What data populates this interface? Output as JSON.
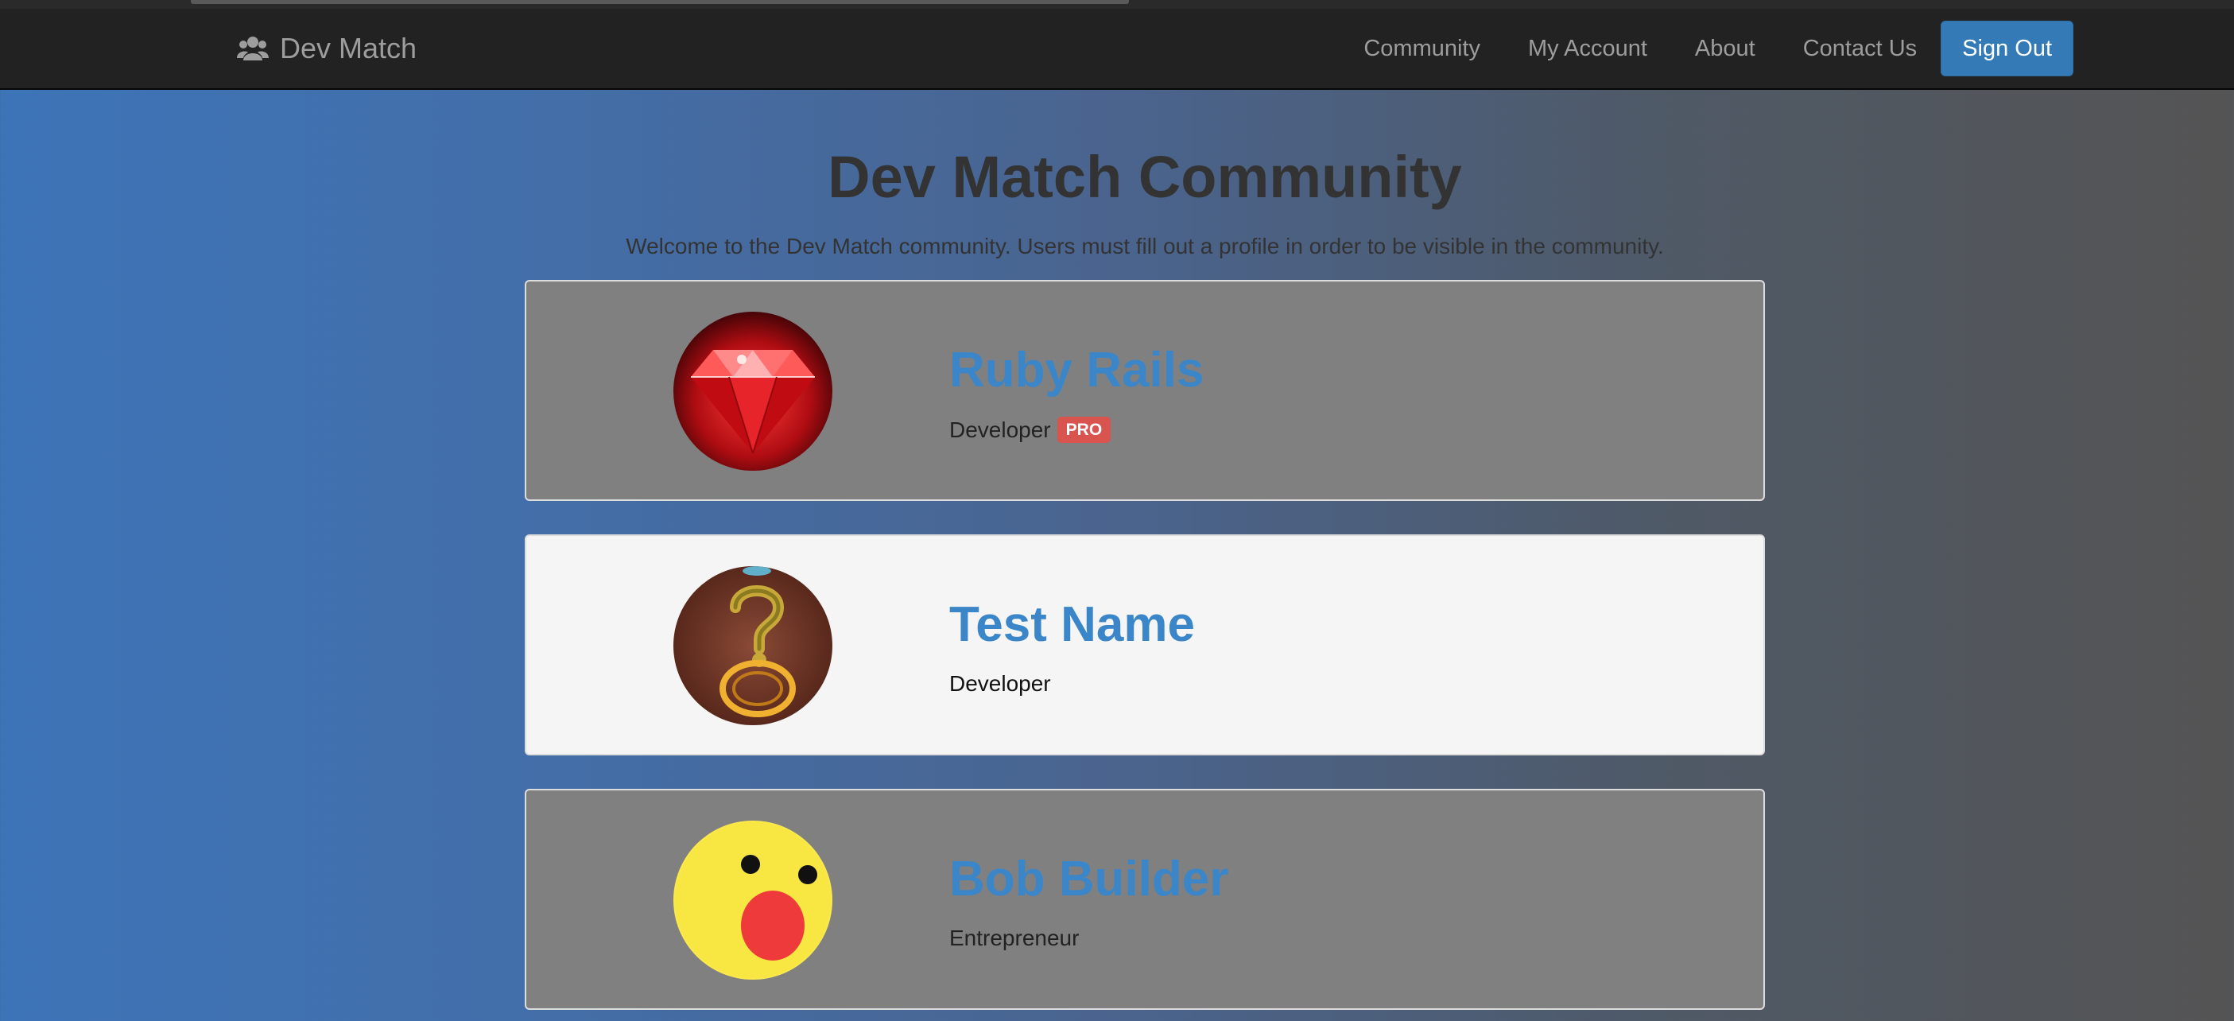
{
  "navbar": {
    "brand_icon": "users-icon",
    "brand": "Dev Match",
    "links": [
      "Community",
      "My Account",
      "About",
      "Contact Us"
    ],
    "sign_out": "Sign Out"
  },
  "page": {
    "title": "Dev Match Community",
    "subtitle": "Welcome to the Dev Match community. Users must fill out a profile in order to be visible in the community."
  },
  "profiles": [
    {
      "name": "Ruby Rails",
      "job_title": "Developer",
      "badge": "PRO",
      "avatar": "ruby-gem-avatar"
    },
    {
      "name": "Test Name",
      "job_title": "Developer",
      "avatar": "question-mark-avatar"
    },
    {
      "name": "Bob Builder",
      "job_title": "Entrepreneur",
      "avatar": "surprised-face-avatar"
    }
  ],
  "colors": {
    "navbar": "#222222",
    "link": "#9d9d9d",
    "primary": "#337ab7",
    "name": "#3a86c8",
    "badge": "#d9534f"
  }
}
